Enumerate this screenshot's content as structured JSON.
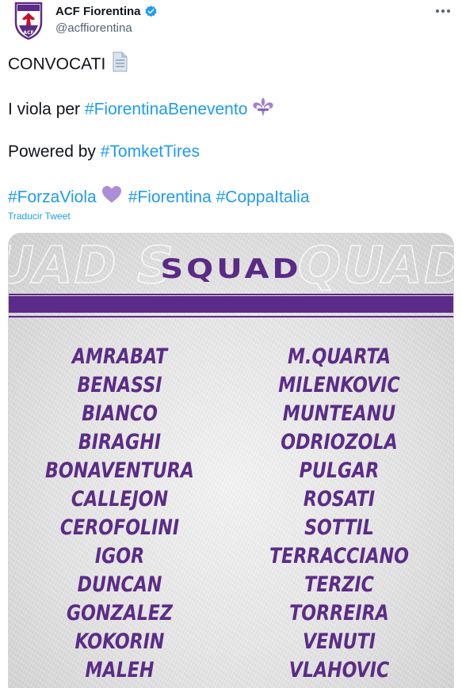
{
  "account": {
    "name": "ACF Fiorentina",
    "handle": "@acffiorentina",
    "verified": true,
    "avatar_icon": "fiorentina-crest-icon",
    "more_icon": "more-horizontal-icon"
  },
  "tweet": {
    "line1": {
      "text": "CONVOCATI",
      "emoji": "page-icon"
    },
    "line2": {
      "prefix": "I viola per ",
      "hashtag": "#FiorentinaBenevento",
      "emoji": "fleur-de-lis-icon"
    },
    "line3": {
      "prefix": "Powered by ",
      "hashtag": "#TomketTires"
    },
    "line4": {
      "hashtag1": "#ForzaViola",
      "emoji": "purple-heart-icon",
      "hashtag2": "#Fiorentina",
      "hashtag3": "#CoppaItalia"
    },
    "translate_label": "Traducir Tweet"
  },
  "media": {
    "title": "SQUAD",
    "players_left": [
      "AMRABAT",
      "BENASSI",
      "BIANCO",
      "BIRAGHI",
      "BONAVENTURA",
      "CALLEJON",
      "CEROFOLINI",
      "IGOR",
      "DUNCAN",
      "GONZALEZ",
      "KOKORIN",
      "MALEH"
    ],
    "players_right": [
      "M.QUARTA",
      "MILENKOVIC",
      "MUNTEANU",
      "ODRIOZOLA",
      "PULGAR",
      "ROSATI",
      "SOTTIL",
      "TERRACCIANO",
      "TERZIC",
      "TORREIRA",
      "VENUTI",
      "VLAHOVIC"
    ]
  },
  "colors": {
    "link": "#1d9bf0",
    "text": "#0f1419",
    "secondary": "#536471",
    "viola": "#5b2c87"
  }
}
